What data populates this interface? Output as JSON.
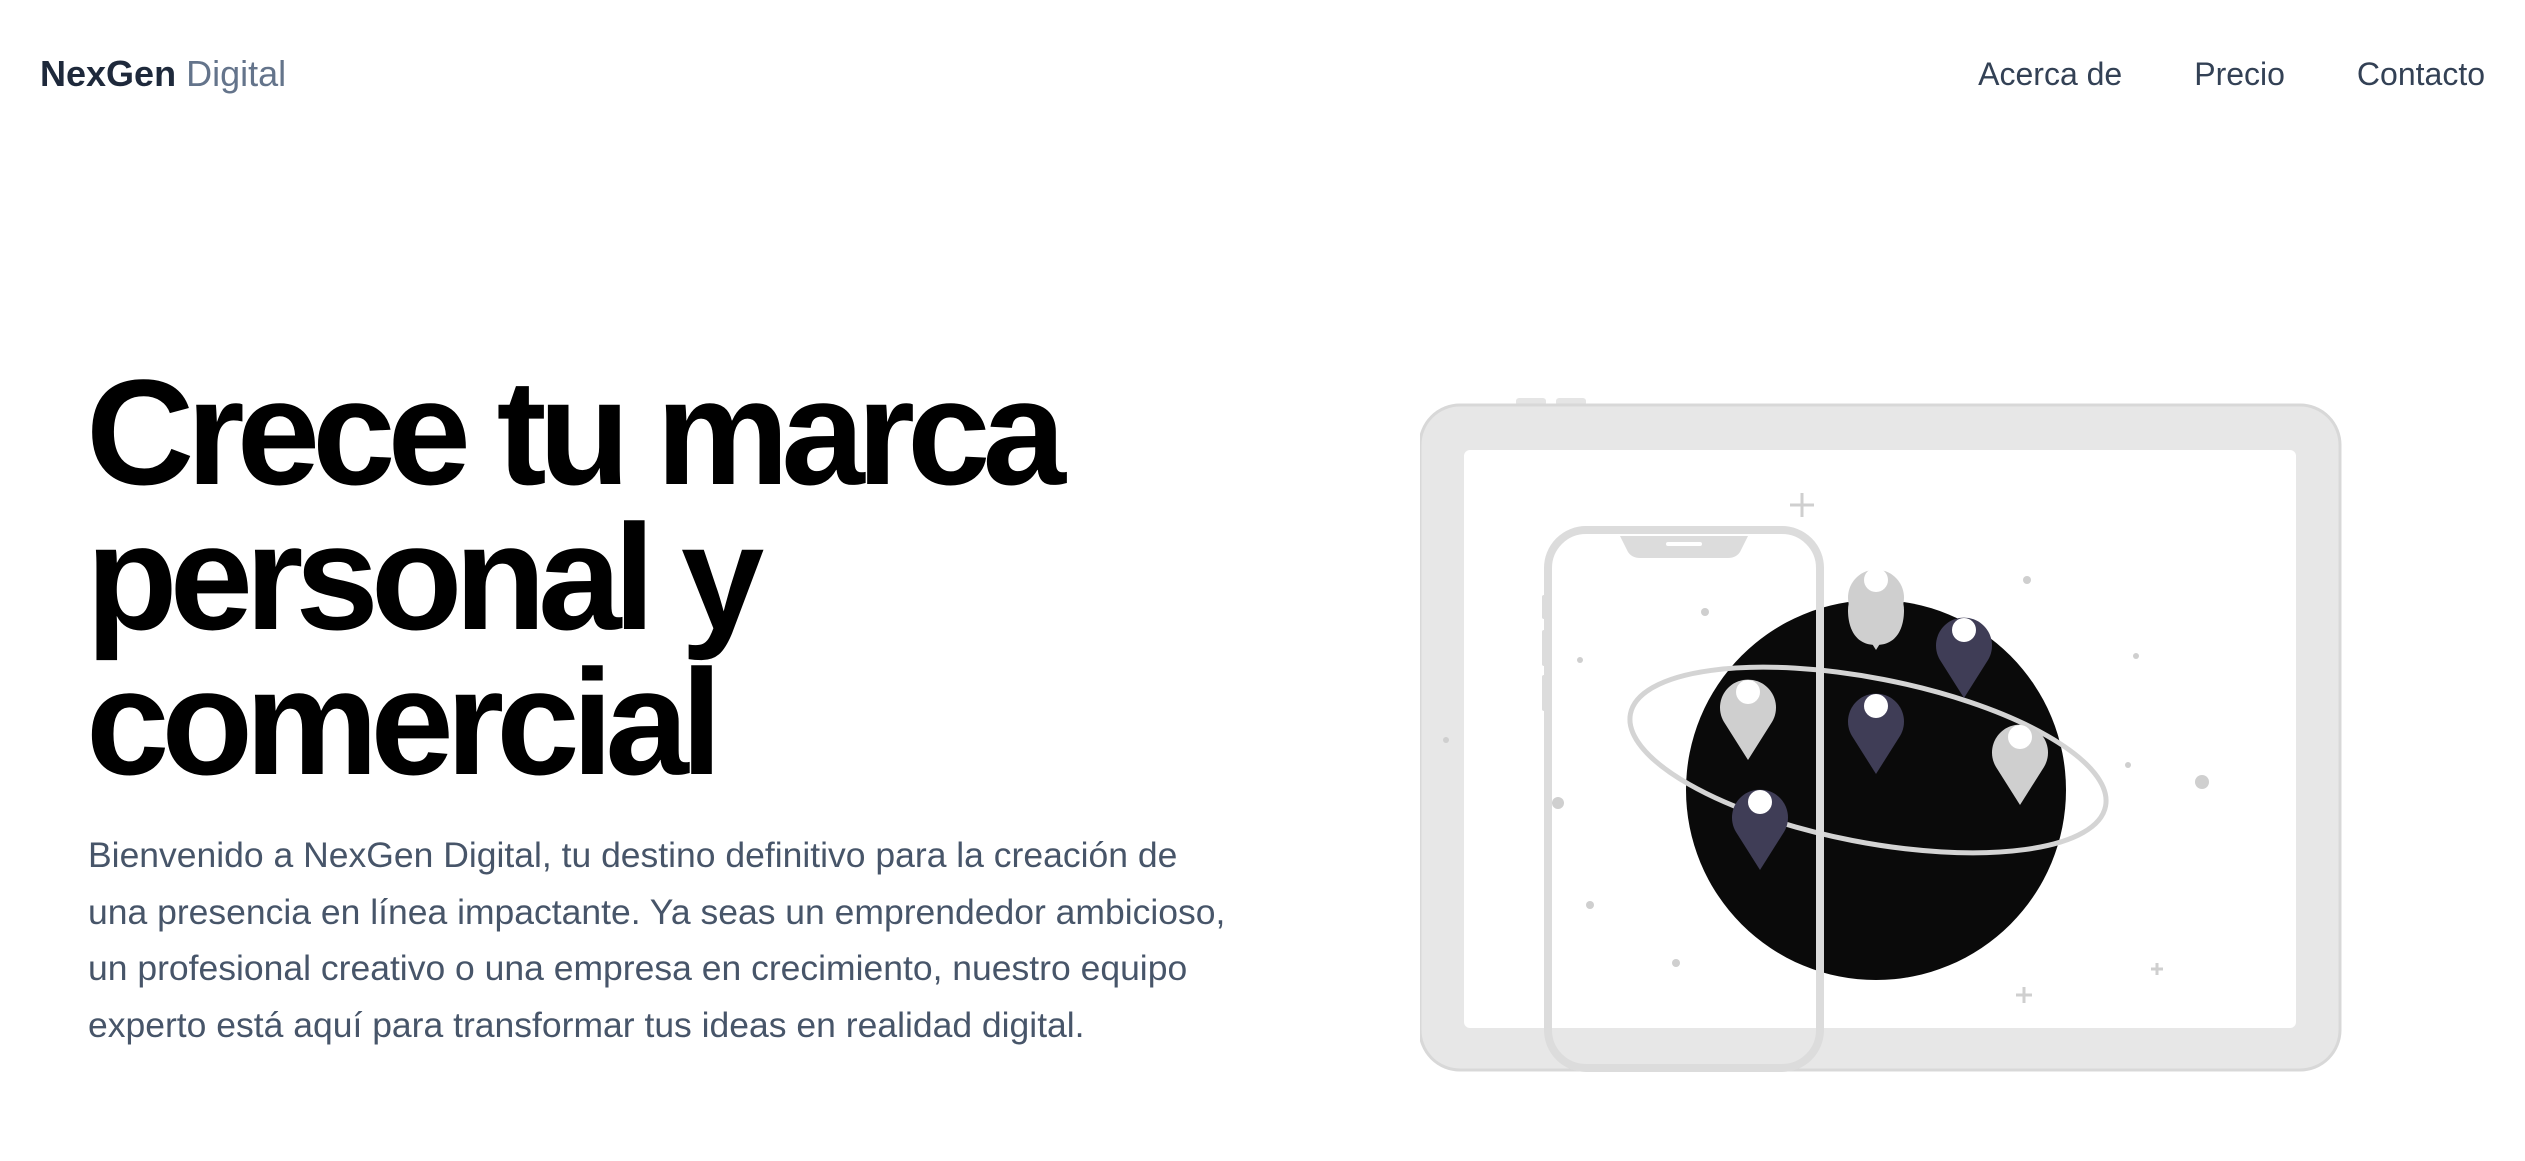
{
  "header": {
    "brand_bold": "NexGen",
    "brand_light": "Digital",
    "nav": [
      {
        "label": "Acerca de"
      },
      {
        "label": "Precio"
      },
      {
        "label": "Contacto"
      }
    ]
  },
  "hero": {
    "title": "Crece tu marca personal y comercial",
    "description": "Bienvenido a NexGen Digital, tu destino definitivo para la creación de una presencia en línea impactante. Ya seas un emprendedor ambicioso, un profesional creativo o una empresa en crecimiento, nuestro equipo experto está aquí para transformar tus ideas en realidad digital."
  },
  "illustration": {
    "icons": [
      "tablet-icon",
      "phone-icon",
      "globe-icon",
      "map-pin-icon"
    ],
    "colors": {
      "device_frame": "#e5e5e5",
      "device_outline": "#d4d4d4",
      "globe": "#0a0a0a",
      "pin_light": "#cfcfcf",
      "pin_dark": "#3f3d56"
    }
  }
}
